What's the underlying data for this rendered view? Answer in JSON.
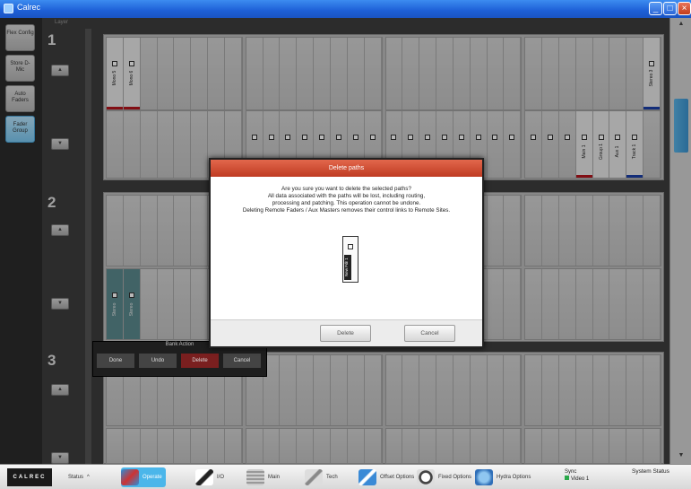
{
  "window": {
    "title": "Calrec"
  },
  "window_buttons": {
    "minimize": "_",
    "maximize": "□",
    "close": "×"
  },
  "left_panel": {
    "buttons": [
      {
        "label": "Flex Config"
      },
      {
        "label": "Store D-Mic"
      },
      {
        "label": "Auto Faders"
      },
      {
        "label": "Fader Group"
      }
    ]
  },
  "workspace": {
    "header": "Layer",
    "layers": [
      {
        "number": "1"
      },
      {
        "number": "2"
      },
      {
        "number": "3"
      }
    ],
    "fader_labels": {
      "layer1_top": [
        "Mono 5",
        "Mono 6"
      ],
      "layer1_right": "Stereo 3",
      "layer1_bottom": [
        "Main 1",
        "Group 1",
        "Aux 1",
        "Track 1"
      ],
      "layer2_left": [
        "Stereo",
        "Stereo"
      ]
    }
  },
  "modal": {
    "title": "Delete paths",
    "lines": [
      "Are you sure you want to delete the selected paths?",
      "All data associated with the paths will be lost, including routing,",
      "processing and patching.  This operation cannot be undone.",
      "Deleting Remote Faders / Aux Masters removes their control links to Remote Sites."
    ],
    "preview_label": "New Fdr 1",
    "buttons": {
      "delete": "Delete",
      "cancel": "Cancel"
    }
  },
  "bank_action": {
    "title": "Bank Action",
    "buttons": [
      "Done",
      "Undo",
      "Delete",
      "Cancel"
    ]
  },
  "taskbar": {
    "logo": "CALREC",
    "status": "Status",
    "items": [
      "Operate",
      "I/O",
      "Main",
      "Tech",
      "Offset Options",
      "Fixed Options",
      "Hydra Options"
    ],
    "sync_label": "Sync",
    "sync_value": "Video 1",
    "system_status": "System Status"
  },
  "colors": {
    "accent": "#4bb6ea",
    "modal_header": "#d0503a",
    "sync_ok": "#2aa84a"
  }
}
